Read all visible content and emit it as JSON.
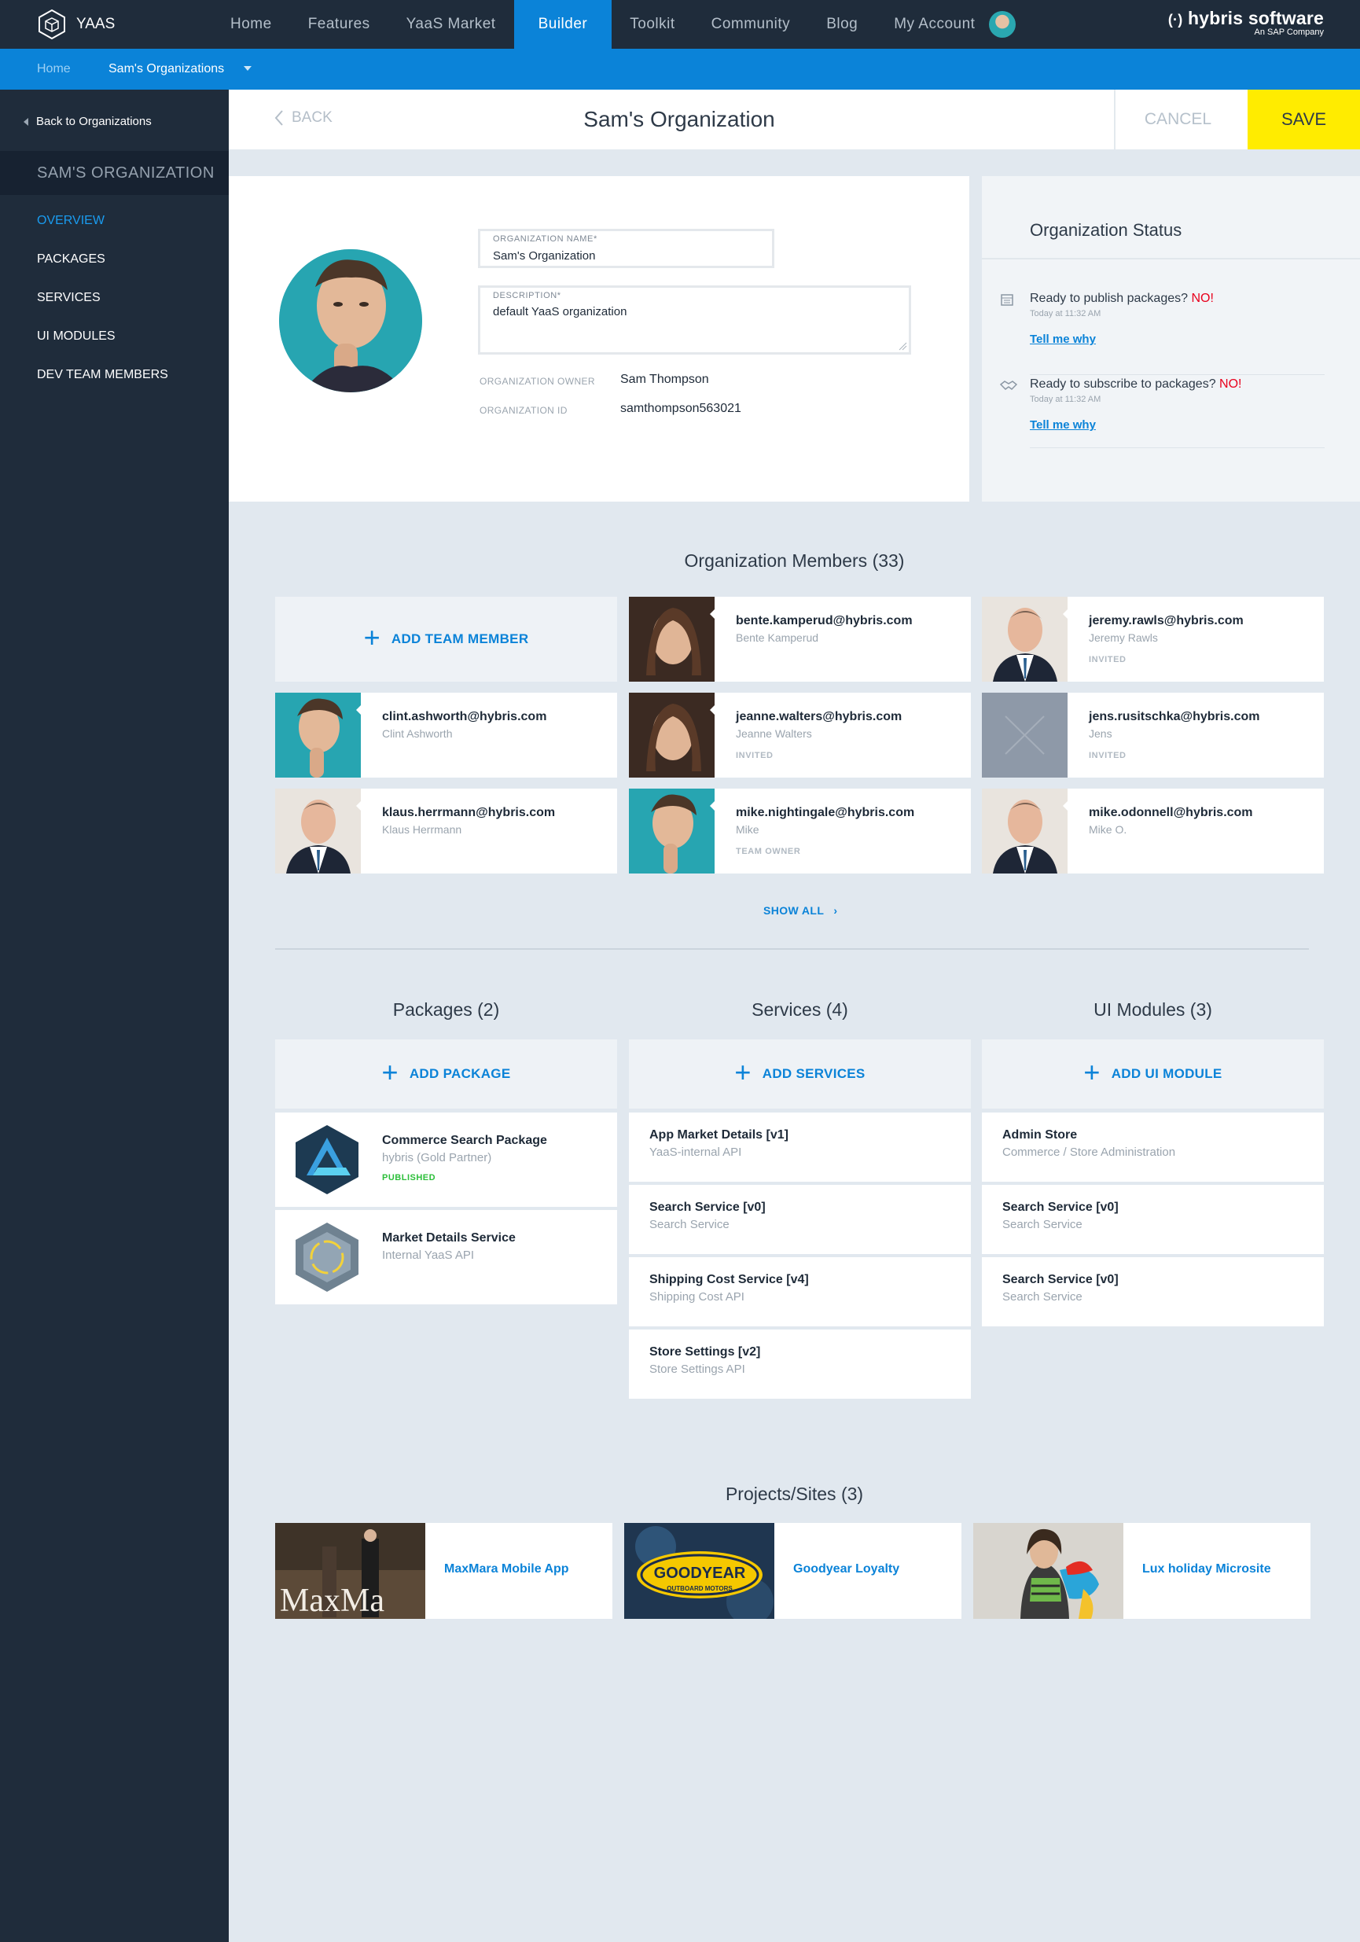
{
  "topnav": {
    "logo_text": "YAAS",
    "items": [
      "Home",
      "Features",
      "YaaS Market",
      "Builder",
      "Toolkit",
      "Community",
      "Blog",
      "My Account"
    ],
    "active": "Builder",
    "brand": "hybris software",
    "brand_sub": "An SAP Company"
  },
  "breadcrumb": {
    "home": "Home",
    "current": "Sam's Organizations"
  },
  "sidebar": {
    "back_label": "Back to Organizations",
    "org_heading": "SAM'S ORGANIZATION",
    "items": [
      "OVERVIEW",
      "PACKAGES",
      "SERVICES",
      "UI MODULES",
      "DEV TEAM MEMBERS"
    ]
  },
  "header": {
    "back": "BACK",
    "title": "Sam's Organization",
    "cancel": "CANCEL",
    "save": "SAVE"
  },
  "details": {
    "name_label": "ORGANIZATION NAME*",
    "name_value": "Sam's Organization",
    "desc_label": "DESCRIPTION*",
    "desc_value": "default YaaS organization",
    "owner_label": "ORGANIZATION OWNER",
    "owner_value": "Sam Thompson",
    "id_label": "ORGANIZATION ID",
    "id_value": "samthompson563021"
  },
  "status": {
    "title": "Organization Status",
    "items": [
      {
        "question": "Ready to publish packages?",
        "answer": "NO!",
        "time": "Today at 11:32 AM",
        "link": "Tell me why"
      },
      {
        "question": "Ready to subscribe to packages?",
        "answer": "NO!",
        "time": "Today at 11:32 AM",
        "link": "Tell me why"
      }
    ]
  },
  "members": {
    "title": "Organization Members",
    "count": "(33)",
    "add_label": "ADD TEAM MEMBER",
    "show_all": "SHOW ALL",
    "list": [
      {
        "email": "bente.kamperud@hybris.com",
        "name": "Bente Kamperud",
        "tag": ""
      },
      {
        "email": "jeremy.rawls@hybris.com",
        "name": "Jeremy Rawls",
        "tag": "INVITED"
      },
      {
        "email": "clint.ashworth@hybris.com",
        "name": "Clint Ashworth",
        "tag": ""
      },
      {
        "email": "jeanne.walters@hybris.com",
        "name": "Jeanne Walters",
        "tag": "INVITED"
      },
      {
        "email": "jens.rusitschka@hybris.com",
        "name": "Jens",
        "tag": "INVITED"
      },
      {
        "email": "klaus.herrmann@hybris.com",
        "name": "Klaus Herrmann",
        "tag": ""
      },
      {
        "email": "mike.nightingale@hybris.com",
        "name": "Mike",
        "tag": "TEAM OWNER"
      },
      {
        "email": "mike.odonnell@hybris.com",
        "name": "Mike O.",
        "tag": ""
      }
    ]
  },
  "packages": {
    "title": "Packages",
    "count": "(2)",
    "add_label": "ADD PACKAGE",
    "list": [
      {
        "name": "Commerce Search Package",
        "sub": "hybris (Gold Partner)",
        "badge": "PUBLISHED"
      },
      {
        "name": "Market Details Service",
        "sub": "Internal YaaS API",
        "badge": ""
      }
    ]
  },
  "services": {
    "title": "Services",
    "count": "(4)",
    "add_label": "ADD SERVICES",
    "list": [
      {
        "name": "App Market Details [v1]",
        "sub": "YaaS-internal API"
      },
      {
        "name": "Search Service [v0]",
        "sub": "Search Service"
      },
      {
        "name": "Shipping Cost Service [v4]",
        "sub": "Shipping Cost API"
      },
      {
        "name": "Store Settings [v2]",
        "sub": "Store Settings API"
      }
    ]
  },
  "modules": {
    "title": "UI Modules",
    "count": "(3)",
    "add_label": "ADD UI MODULE",
    "list": [
      {
        "name": "Admin Store",
        "sub": "Commerce / Store Administration"
      },
      {
        "name": "Search Service [v0]",
        "sub": "Search Service"
      },
      {
        "name": "Search Service [v0]",
        "sub": "Search Service"
      }
    ]
  },
  "projects": {
    "title": "Projects/Sites",
    "count": "(3)",
    "list": [
      "MaxMara Mobile App",
      "Goodyear Loyalty",
      "Lux holiday Microsite"
    ],
    "logo_text": [
      "MaxMa",
      "GOODYEAR",
      "OUTBOARD MOTORS"
    ]
  },
  "colors": {
    "accent": "#0b83d8",
    "nav_bg": "#1f2c3b",
    "save": "#ffec00",
    "alert": "#e8001c",
    "published": "#2cbf3a"
  }
}
